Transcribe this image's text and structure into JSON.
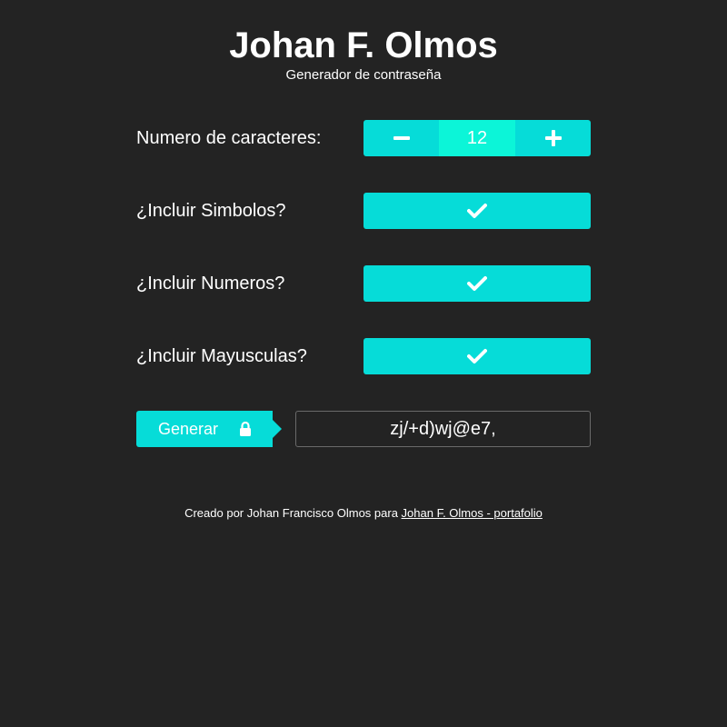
{
  "header": {
    "title": "Johan F. Olmos",
    "subtitle": "Generador de contraseña"
  },
  "length_row": {
    "label": "Numero de caracteres:",
    "value": "12",
    "decrease_icon": "minus-icon",
    "increase_icon": "plus-icon"
  },
  "options": [
    {
      "label": "¿Incluir Simbolos?",
      "checked": true,
      "icon": "check-icon"
    },
    {
      "label": "¿Incluir Numeros?",
      "checked": true,
      "icon": "check-icon"
    },
    {
      "label": "¿Incluir Mayusculas?",
      "checked": true,
      "icon": "check-icon"
    }
  ],
  "generate": {
    "button_label": "Generar",
    "icon": "lock-icon",
    "output": "zj/+d)wj@e7,"
  },
  "footer": {
    "text": "Creado por Johan Francisco Olmos para ",
    "link_text": "Johan F. Olmos - portafolio"
  },
  "colors": {
    "background": "#232323",
    "accent": "#06dcd8",
    "accent_highlight": "#0cf5d8",
    "text": "#ffffff",
    "output_border": "#6a6a6a"
  }
}
